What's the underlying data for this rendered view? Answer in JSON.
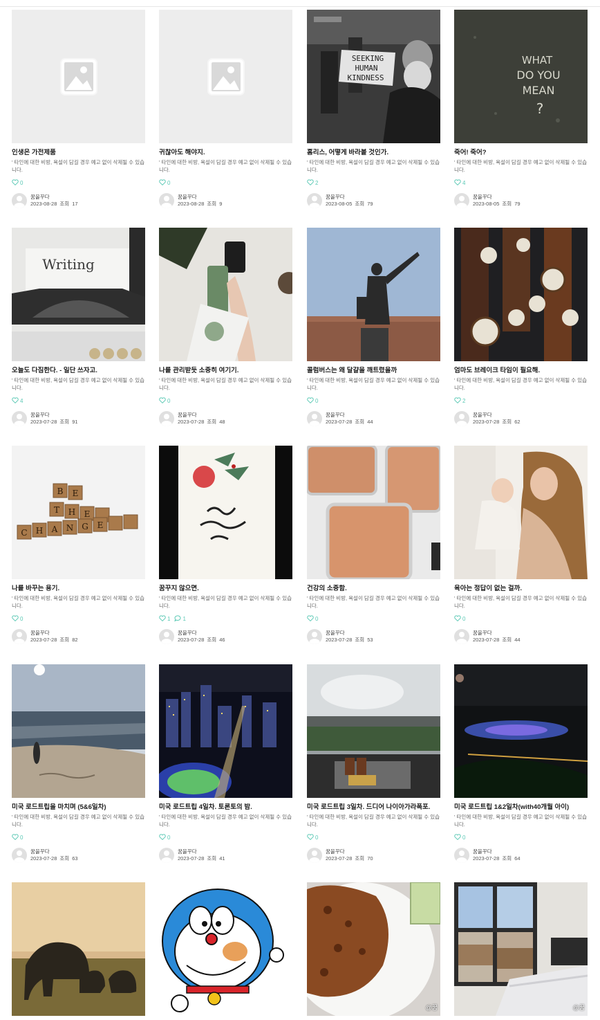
{
  "notice_text": "' 타인에 대한 비방, 욕설이 담길 경우 예고 없이 삭제될 수 있습니다.",
  "author": "꿈을꾸다",
  "view_prefix": "조회",
  "accent_color": "#5cc9b5",
  "posts": [
    {
      "title": "인생은 가전제품",
      "likes": "0",
      "comments": "",
      "date": "2023-08-28",
      "views": "17",
      "image": "placeholder-image"
    },
    {
      "title": "귀찮아도 해야지.",
      "likes": "0",
      "comments": "",
      "date": "2023-08-28",
      "views": "9",
      "image": "placeholder-image"
    },
    {
      "title": "홈리스, 어떻게 바라볼 것인가.",
      "likes": "2",
      "comments": "",
      "date": "2023-08-05",
      "views": "79",
      "image": "homeless-man-sign-photo"
    },
    {
      "title": "죽어! 죽어?",
      "likes": "4",
      "comments": "",
      "date": "2023-08-05",
      "views": "79",
      "image": "what-do-you-mean-chalk-photo"
    },
    {
      "title": "오늘도 다짐한다. - 일단 쓰자고.",
      "likes": "4",
      "comments": "",
      "date": "2023-07-28",
      "views": "91",
      "image": "typewriter-writing-photo"
    },
    {
      "title": "나를 관리받듯 소중히 여기기.",
      "likes": "0",
      "comments": "",
      "date": "2023-07-28",
      "views": "48",
      "image": "skincare-hand-photo"
    },
    {
      "title": "콜럼버스는 왜 달걀을 깨트렸을까",
      "likes": "0",
      "comments": "",
      "date": "2023-07-28",
      "views": "44",
      "image": "columbus-statue-photo"
    },
    {
      "title": "엄마도 브레이크 타임이 필요해.",
      "likes": "2",
      "comments": "",
      "date": "2023-07-28",
      "views": "62",
      "image": "clocks-wall-photo"
    },
    {
      "title": "나를 바꾸는 용기.",
      "likes": "0",
      "comments": "",
      "date": "2023-07-28",
      "views": "82",
      "image": "be-the-change-tiles-photo"
    },
    {
      "title": "꿈꾸지 않으면.",
      "likes": "1",
      "comments": "1",
      "date": "2023-07-28",
      "views": "46",
      "image": "calligraphy-card-photo"
    },
    {
      "title": "건강의 소중함.",
      "likes": "0",
      "comments": "",
      "date": "2023-07-28",
      "views": "53",
      "image": "baby-food-containers-photo"
    },
    {
      "title": "육아는 정답이 없는 걸까.",
      "likes": "0",
      "comments": "",
      "date": "2023-07-28",
      "views": "44",
      "image": "mother-baby-photo"
    },
    {
      "title": "미국 로드트립을 마치며 (5&6일차)",
      "likes": "0",
      "comments": "",
      "date": "2023-07-28",
      "views": "63",
      "image": "beach-sunset-photo"
    },
    {
      "title": "미국 로드트립 4일차. 토론토의 밤.",
      "likes": "0",
      "comments": "",
      "date": "2023-07-28",
      "views": "41",
      "image": "toronto-night-photo"
    },
    {
      "title": "미국 로드트립 3일차. 드디어 나이아가라폭포.",
      "likes": "0",
      "comments": "",
      "date": "2023-07-28",
      "views": "70",
      "image": "niagara-window-photo"
    },
    {
      "title": "미국 로드트립 1&2일차(with40개월 아이)",
      "likes": "0",
      "comments": "",
      "date": "2023-07-28",
      "views": "64",
      "image": "niagara-night-photo"
    },
    {
      "title": "",
      "likes": "",
      "comments": "",
      "date": "",
      "views": "",
      "image": "elephants-sunset-photo"
    },
    {
      "title": "",
      "likes": "",
      "comments": "",
      "date": "",
      "views": "",
      "image": "doraemon-drawing"
    },
    {
      "title": "",
      "likes": "",
      "comments": "",
      "date": "",
      "views": "",
      "image": "food-plate-photo",
      "watermark": "@꿈"
    },
    {
      "title": "",
      "likes": "",
      "comments": "",
      "date": "",
      "views": "",
      "image": "bedroom-window-photo",
      "watermark": "@꿈"
    }
  ]
}
